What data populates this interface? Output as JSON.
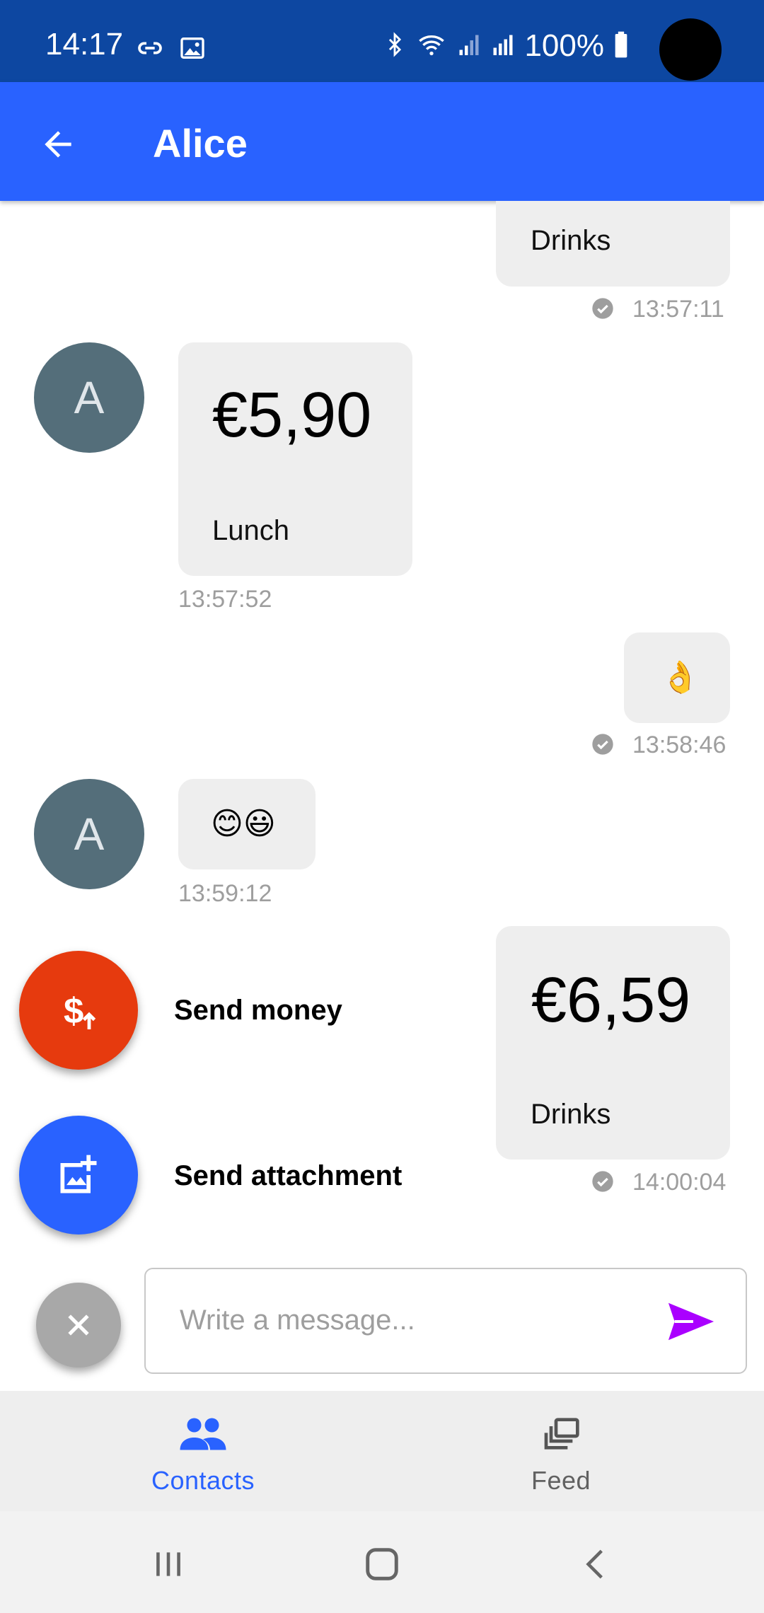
{
  "status_bar": {
    "time": "14:17",
    "battery": "100%",
    "icons": [
      "link-icon",
      "image-icon",
      "bluetooth-icon",
      "wifi-icon",
      "signal-icon",
      "signal-roaming-icon",
      "battery-icon"
    ]
  },
  "app_bar": {
    "title": "Alice",
    "back_icon": "arrow-back-icon"
  },
  "messages": [
    {
      "direction": "outgoing",
      "note": "Drinks",
      "time": "13:57:11",
      "status": "delivered"
    },
    {
      "direction": "incoming",
      "avatar": "A",
      "amount": "€5,90",
      "note": "Lunch",
      "time": "13:57:52"
    },
    {
      "direction": "outgoing",
      "emoji": "👌",
      "time": "13:58:46",
      "status": "delivered"
    },
    {
      "direction": "incoming",
      "avatar": "A",
      "emoji": "😊😃",
      "time": "13:59:12"
    },
    {
      "direction": "outgoing",
      "amount": "€6,59",
      "note": "Drinks",
      "time": "14:00:04",
      "status": "delivered"
    }
  ],
  "fab_menu": {
    "send_money_label": "Send money",
    "send_attachment_label": "Send attachment",
    "colors": {
      "money": "#e63a0e",
      "attachment": "#2962ff",
      "close": "#a8a8a8"
    }
  },
  "composer": {
    "placeholder": "Write a message...",
    "send_color": "#aa00ff"
  },
  "bottom_nav": {
    "items": [
      {
        "label": "Contacts",
        "icon": "people-icon",
        "active": true
      },
      {
        "label": "Feed",
        "icon": "feed-icon",
        "active": false
      }
    ],
    "active_color": "#2962ff",
    "inactive_color": "#616161"
  },
  "colors": {
    "status_bar": "#0d47a1",
    "app_bar": "#2962ff",
    "bubble": "#eeeeee",
    "avatar": "#546e7a"
  }
}
